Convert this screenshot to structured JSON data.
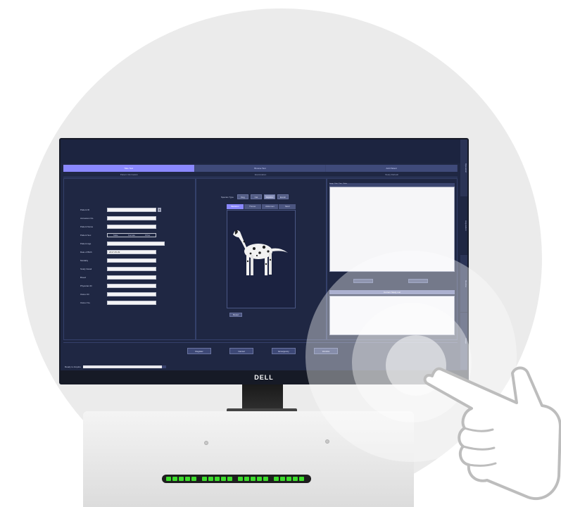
{
  "monitor": {
    "brand": "DELL"
  },
  "app": {
    "main_tabs": [
      {
        "label": "Take Test",
        "active": true
      },
      {
        "label": "Browse Test",
        "active": false
      },
      {
        "label": "Add Patient",
        "active": false
      }
    ],
    "section_heads": [
      "Patient Information",
      "Examination",
      "Study Refresh"
    ],
    "patient_form": {
      "fields": [
        {
          "label": "Patient ID",
          "value": "",
          "has_dropdown": true
        },
        {
          "label": "Accession No.",
          "value": ""
        },
        {
          "label": "Patient Name",
          "value": ""
        },
        {
          "label": "Patient Sex",
          "type": "radio",
          "options": [
            "Male",
            "Female",
            "Other"
          ]
        },
        {
          "label": "Patient Age",
          "value": ""
        },
        {
          "label": "Date of Birth",
          "value": "2017-05-09"
        },
        {
          "label": "Modality",
          "value": ""
        },
        {
          "label": "Study Detail",
          "value": ""
        },
        {
          "label": "Breed",
          "value": ""
        },
        {
          "label": "Physician ID",
          "value": ""
        },
        {
          "label": "Owner ID",
          "value": ""
        },
        {
          "label": "Owner No.",
          "value": ""
        }
      ]
    },
    "species": {
      "label": "Species Type",
      "options": [
        {
          "label": "Dog",
          "active": false
        },
        {
          "label": "Cat",
          "active": false
        },
        {
          "label": "Equine",
          "active": true
        },
        {
          "label": "Exotic",
          "active": false
        }
      ]
    },
    "view_tabs": [
      {
        "label": "Skeleton",
        "active": true
      },
      {
        "label": "Thorax",
        "active": false
      },
      {
        "label": "Abdomen",
        "active": false
      },
      {
        "label": "Skull",
        "active": false
      }
    ],
    "reset_label": "Reset",
    "list_header": "Image · Date · Time · Status",
    "sub_head": "Current Study List",
    "side_tabs": [
      {
        "label": "Operation",
        "active": false
      },
      {
        "label": "Acquisition",
        "active": true
      },
      {
        "label": "Review",
        "active": false
      },
      {
        "label": "Image",
        "active": false
      }
    ],
    "action_buttons": [
      "Register",
      "Cancel",
      "Emergency",
      "Worklist"
    ],
    "status": {
      "label": "Ready to Acquire",
      "progress_fraction": 0.95
    }
  },
  "colors": {
    "screen_bg": "#1f2743",
    "active_tab": "#8a88ff",
    "led_green": "#3ddc2c"
  },
  "icons": [
    "dalmatian-image",
    "touch-hand-icon"
  ]
}
